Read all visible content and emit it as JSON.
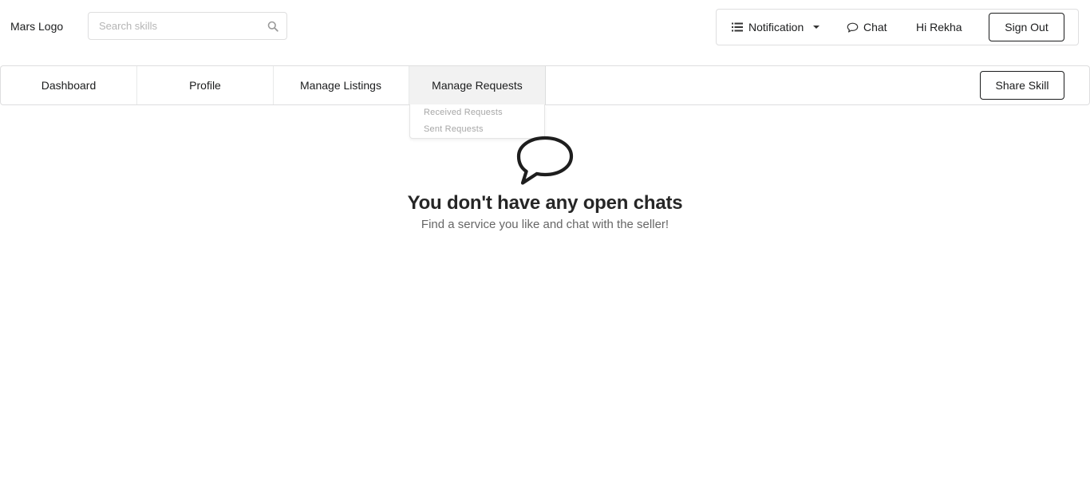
{
  "header": {
    "logo_text": "Mars Logo",
    "search": {
      "placeholder": "Search skills",
      "value": "",
      "icon": "search-icon"
    },
    "notification_label": "Notification",
    "chat_label": "Chat",
    "greeting": "Hi Rekha",
    "sign_out_label": "Sign Out"
  },
  "nav": {
    "items": [
      {
        "label": "Dashboard"
      },
      {
        "label": "Profile"
      },
      {
        "label": "Manage Listings"
      },
      {
        "label": "Manage Requests",
        "active": true
      }
    ],
    "share_skill_label": "Share Skill",
    "dropdown": {
      "items": [
        {
          "label": "Received Requests"
        },
        {
          "label": "Sent Requests"
        }
      ]
    }
  },
  "empty_state": {
    "icon": "speech-bubble-icon",
    "title": "You don't have any open chats",
    "subtitle": "Find a service you like and chat with the seller!"
  }
}
